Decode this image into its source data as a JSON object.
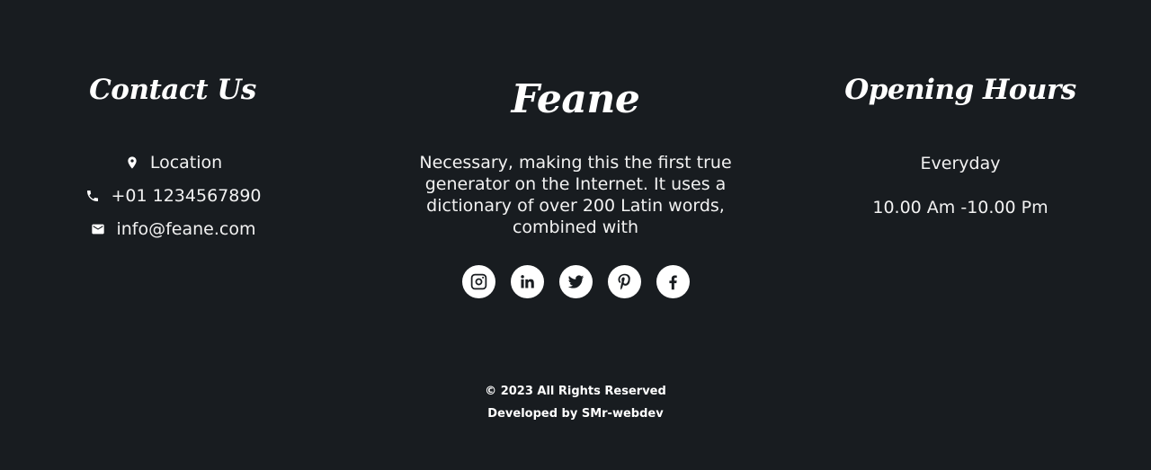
{
  "contact": {
    "title": "Contact Us",
    "items": [
      {
        "icon": "location-pin-icon",
        "text": "Location"
      },
      {
        "icon": "phone-icon",
        "text": "+01 1234567890"
      },
      {
        "icon": "envelope-icon",
        "text": "info@feane.com"
      }
    ]
  },
  "brand": {
    "title": "Feane",
    "description": "Necessary, making this the first true generator on the Internet. It uses a dictionary of over 200 Latin words, combined with",
    "social": [
      "instagram-icon",
      "linkedin-icon",
      "twitter-icon",
      "pinterest-icon",
      "facebook-icon"
    ]
  },
  "hours": {
    "title": "Opening Hours",
    "day": "Everyday",
    "time": "10.00 Am -10.00 Pm"
  },
  "footer_bottom": {
    "copyright": "© 2023 All Rights Reserved",
    "developed": "Developed by SMr-webdev"
  },
  "colors": {
    "background": "#181c20",
    "text": "#ffffff"
  }
}
